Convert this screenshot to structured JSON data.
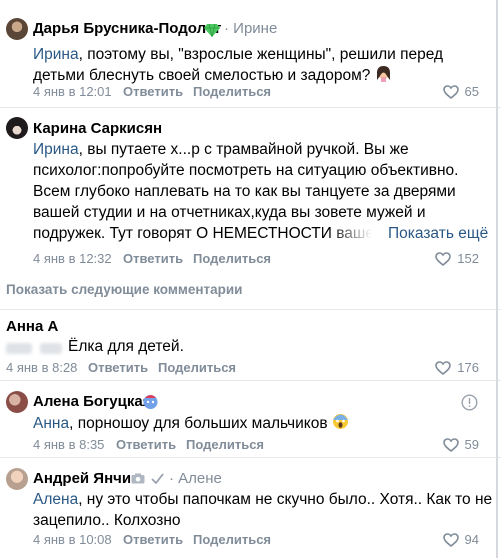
{
  "comments": [
    {
      "author": "Дарья Брусника-Подолог",
      "reply_to": "· Ирине",
      "mention": "Ирина",
      "text": ", поэтому вы, \"взрослые женщины\", решили перед детьми блеснуть своей смелостью и задором?",
      "date": "4 янв в 12:01",
      "reply_label": "Ответить",
      "share_label": "Поделиться",
      "likes": "65"
    },
    {
      "author": "Карина Саркисян",
      "mention": "Ирина",
      "text": ", вы путаете х...р с трамвайной ручкой. Вы же психолог:попробуйте посмотреть на ситуацию объективно. Всем глубоко наплевать на то как вы танцуете за дверями вашей студии и на отчетниках,куда вы зовете мужей и подружек. Тут говорят О НЕМЕСТНОСТИ вашего одеяния и танца на детском концерте без возрастных ограничений. Никто вам тут не завидует",
      "show_more": "Показать ещё",
      "date": "4 янв в 12:32",
      "reply_label": "Ответить",
      "share_label": "Поделиться",
      "likes": "152"
    },
    {
      "author": "Анна А",
      "text": "Ёлка для детей.",
      "date": "4 янв в 8:28",
      "reply_label": "Ответить",
      "share_label": "Поделиться",
      "likes": "176"
    },
    {
      "author": "Алена Богуцкая",
      "mention": "Анна",
      "text": ", порношоу для больших мальчиков",
      "date": "4 янв в 8:35",
      "reply_label": "Ответить",
      "share_label": "Поделиться",
      "likes": "59"
    },
    {
      "author": "Андрей Янчик",
      "reply_to": "· Алене",
      "mention": "Алена",
      "text": ", ну это чтобы папочкам не скучно было.. Хотя.. Как то не зацепило.. Колхозно",
      "date": "4 янв в 10:08",
      "reply_label": "Ответить",
      "share_label": "Поделиться",
      "likes": "94"
    }
  ],
  "show_next_comments": "Показать следующие комментарии",
  "colors": {
    "link": "#2a5885",
    "muted": "#818c99",
    "divider": "#e7e8ec"
  },
  "icons": [
    "verified-gem-icon",
    "heart-icon",
    "info-icon",
    "camera-icon",
    "checkmark-icon",
    "face-emoji",
    "scream-emoji",
    "blue-face-emoji"
  ]
}
